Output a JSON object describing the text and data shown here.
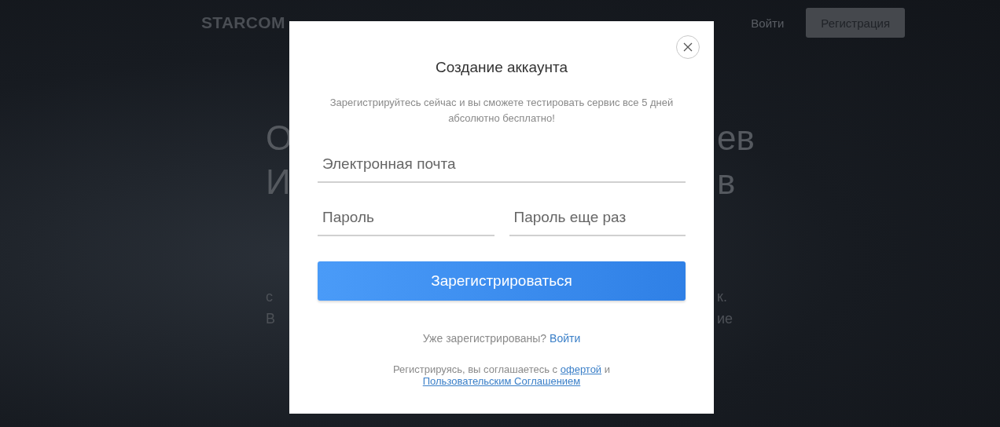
{
  "header": {
    "logo": "STARCOM",
    "login": "Войти",
    "register": "Регистрация"
  },
  "hero": {
    "lines": [
      {
        "left": "О",
        "right": "ев"
      },
      {
        "left": "И",
        "right": "в"
      }
    ],
    "sub_lines": [
      {
        "left": "с",
        "right": "к."
      },
      {
        "left": "В",
        "right": "ие"
      }
    ]
  },
  "modal": {
    "title": "Создание аккаунта",
    "subtitle": "Зарегистрируйтесь сейчас и вы сможете тестировать сервис все 5 дней абсолютно бесплатно!",
    "fields": [
      {
        "placeholder": "Электронная почта"
      },
      {
        "placeholder": "Пароль"
      },
      {
        "placeholder": "Пароль еще раз"
      }
    ],
    "submit": "Зарегистрироваться",
    "login_prompt": "Уже зарегистрированы?",
    "login_link": "Войти",
    "terms_text": "Регистрируясь, вы соглашаетесь с",
    "terms_link_1": "офертой",
    "terms_and": "и",
    "terms_link_2": "Пользовательским Соглашением"
  }
}
